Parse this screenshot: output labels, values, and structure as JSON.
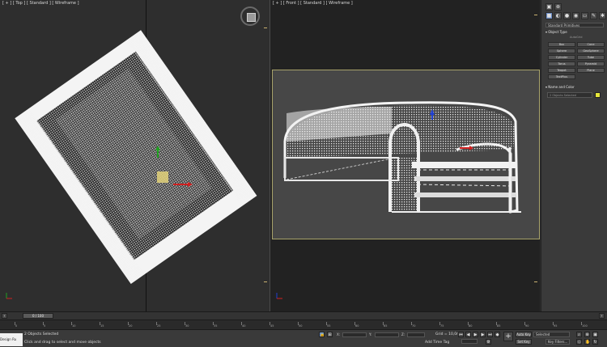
{
  "viewports": {
    "top": {
      "label": "[ + ] [ Top ] [ Standard ] [ Wireframe ]"
    },
    "front": {
      "label": "[ + ] [ Front ] [ Standard ] [ Wireframe ]"
    }
  },
  "command_panel": {
    "category": "Standard Primitives",
    "object_type_header": "Object Type",
    "autogrid": "AutoGrid",
    "object_buttons": [
      "Box",
      "Cone",
      "Sphere",
      "GeoSphere",
      "Cylinder",
      "Tube",
      "Torus",
      "Pyramid",
      "Teapot",
      "Plane",
      "TextPlus"
    ],
    "name_color_header": "Name and Color",
    "name_value": "2 Objects Selected",
    "swatch_color": "#e6e63a"
  },
  "timeline": {
    "frame_label": "0 / 100",
    "ticks": [
      "0",
      "5",
      "10",
      "15",
      "20",
      "25",
      "30",
      "35",
      "40",
      "45",
      "50",
      "55",
      "60",
      "65",
      "70",
      "75",
      "80",
      "85",
      "90",
      "95",
      "100"
    ]
  },
  "status_bar": {
    "maxscript": "Design Ru",
    "selection": "2 Objects Selected",
    "prompt": "Click and drag to select and move objects",
    "x_label": "X:",
    "y_label": "Y:",
    "z_label": "Z:",
    "grid": "Grid = 10,0m",
    "add_time_tag": "Add Time Tag",
    "auto_key": "Auto Key",
    "set_key": "Set Key",
    "selected": "Selected",
    "key_filters": "Key Filters..."
  },
  "colors": {
    "accent_blue": "#6b8cc4",
    "viewport_border": "#a7a26a",
    "gizmo_x": "#d02020",
    "gizmo_y": "#20a020",
    "gizmo_z": "#2040d0"
  }
}
